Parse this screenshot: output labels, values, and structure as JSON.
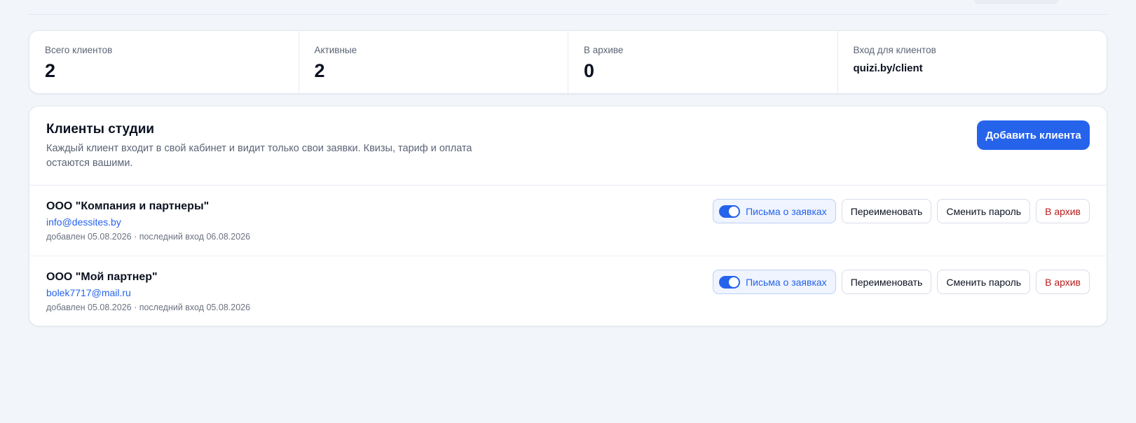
{
  "stats": [
    {
      "label": "Всего клиентов",
      "value": "2"
    },
    {
      "label": "Активные",
      "value": "2"
    },
    {
      "label": "В архиве",
      "value": "0"
    },
    {
      "label": "Вход для клиентов",
      "value": "quizi.by/client"
    }
  ],
  "clients_section": {
    "title": "Клиенты студии",
    "description": "Каждый клиент входит в свой кабинет и видит только свои заявки. Квизы, тариф и оплата остаются вашими.",
    "add_button": "Добавить клиента"
  },
  "clients": [
    {
      "name": "ООО \"Компания и партнеры\"",
      "email": "info@dessites.by",
      "meta": "добавлен 05.08.2026 · последний вход 06.08.2026",
      "toggle_label": "Письма о заявках",
      "toggle_on": true,
      "rename": "Переименовать",
      "change_password": "Сменить пароль",
      "archive": "В архив"
    },
    {
      "name": "ООО \"Мой партнер\"",
      "email": "bolek7717@mail.ru",
      "meta": "добавлен 05.08.2026 · последний вход 05.08.2026",
      "toggle_label": "Письма о заявках",
      "toggle_on": true,
      "rename": "Переименовать",
      "change_password": "Сменить пароль",
      "archive": "В архив"
    }
  ],
  "colors": {
    "accent": "#2563eb",
    "danger": "#b91c1c",
    "background": "#f2f5fa"
  }
}
